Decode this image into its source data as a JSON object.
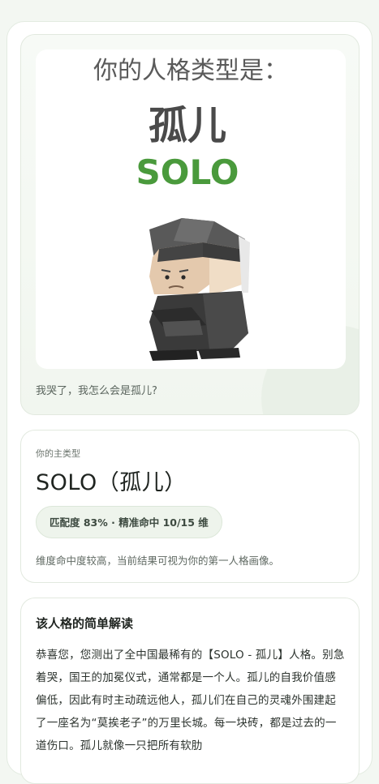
{
  "hero": {
    "heading": "你的人格类型是：",
    "cn_name": "孤儿",
    "en_name": "SOLO",
    "caption": "我哭了，我怎么会是孤儿?"
  },
  "main": {
    "label": "你的主类型",
    "type_name": "SOLO（孤儿）",
    "match_pill": "匹配度 83% · 精准命中 10/15 维",
    "note": "维度命中度较高，当前结果可视为你的第一人格画像。"
  },
  "desc": {
    "title": "该人格的简单解读",
    "body": "恭喜您，您测出了全中国最稀有的【SOLO - 孤儿】人格。别急着哭，国王的加冕仪式，通常都是一个人。孤儿的自我价值感偏低，因此有时主动疏远他人，孤儿们在自己的灵魂外围建起了一座名为“莫挨老子”的万里长城。每一块砖，都是过去的一道伤口。孤儿就像一只把所有软肋"
  },
  "colors": {
    "accent_green": "#4a9a3c",
    "heading_gray": "#5a5a5a"
  }
}
